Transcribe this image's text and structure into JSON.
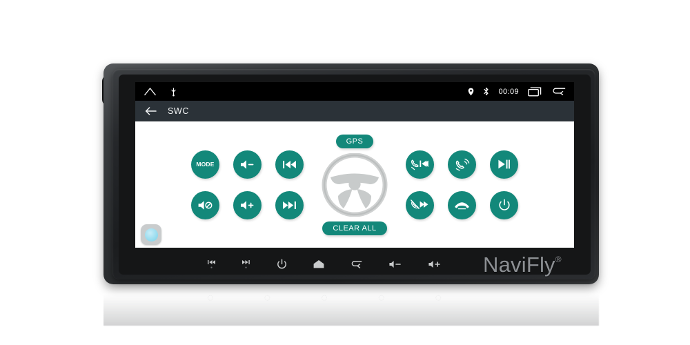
{
  "device": {
    "brand_logo": "NaviFly",
    "brand_mark": "®"
  },
  "status_bar": {
    "home_icon": "home-icon",
    "usb_icon": "usb-icon",
    "location_icon": "location-pin-icon",
    "bluetooth_icon": "bluetooth-icon",
    "time": "00:09",
    "recents_icon": "recent-apps-icon",
    "back_icon": "back-arrow-icon"
  },
  "title_bar": {
    "back_icon": "back-arrow-icon",
    "title": "SWC"
  },
  "center": {
    "gps_label": "GPS",
    "clear_all_label": "CLEAR ALL",
    "wheel_icon": "steering-wheel-icon"
  },
  "left_buttons": [
    {
      "id": "mode",
      "label": "MODE",
      "icon": "mode-text",
      "row": 0
    },
    {
      "id": "volume-down",
      "label": "",
      "icon": "volume-down-icon",
      "row": 0
    },
    {
      "id": "prev-track",
      "label": "",
      "icon": "previous-track-icon",
      "row": 0
    },
    {
      "id": "mute",
      "label": "",
      "icon": "volume-mute-icon",
      "row": 1
    },
    {
      "id": "volume-up",
      "label": "",
      "icon": "volume-up-icon",
      "row": 1
    },
    {
      "id": "next-track",
      "label": "",
      "icon": "next-track-icon",
      "row": 1
    }
  ],
  "right_buttons": [
    {
      "id": "call-prev",
      "label": "",
      "icon": "phone-previous-icon",
      "row": 0
    },
    {
      "id": "answer-call",
      "label": "",
      "icon": "phone-answer-icon",
      "row": 0
    },
    {
      "id": "play-pause",
      "label": "",
      "icon": "play-pause-icon",
      "row": 0
    },
    {
      "id": "call-next",
      "label": "",
      "icon": "phone-muted-next-icon",
      "row": 1
    },
    {
      "id": "hang-up",
      "label": "",
      "icon": "phone-hangup-icon",
      "row": 1
    },
    {
      "id": "power",
      "label": "",
      "icon": "power-icon",
      "row": 1
    }
  ],
  "floating_button": {
    "icon": "assistive-touch-icon"
  },
  "hard_keys": [
    {
      "id": "prev",
      "icon": "previous-track-icon"
    },
    {
      "id": "next",
      "icon": "next-track-icon"
    },
    {
      "id": "power",
      "icon": "power-icon"
    },
    {
      "id": "home",
      "icon": "home-icon"
    },
    {
      "id": "back",
      "icon": "back-arrow-icon"
    },
    {
      "id": "vol-down",
      "icon": "volume-down-icon"
    },
    {
      "id": "vol-up",
      "icon": "volume-up-icon"
    }
  ],
  "colors": {
    "accent_teal": "#13887a",
    "title_bar": "#2b3238",
    "screen_bg": "#ffffff",
    "status_bar": "#000000",
    "wheel_gray": "#c4c6c6",
    "logo_gray": "#8d9094"
  }
}
